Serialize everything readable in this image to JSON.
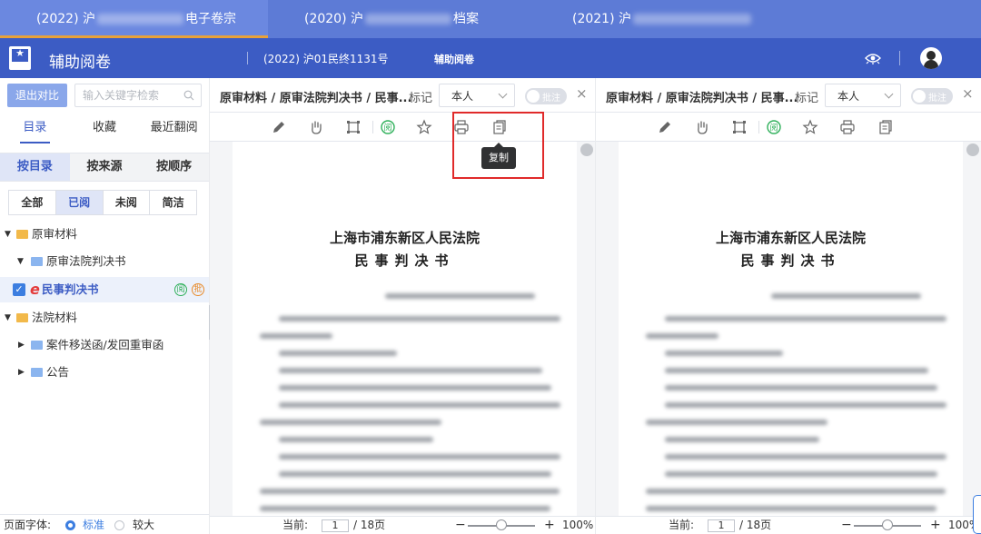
{
  "tabs": [
    {
      "prefix": "(2022) 沪",
      "suffix": "电子卷宗",
      "active": true
    },
    {
      "prefix": "(2020) 沪",
      "suffix": "档案",
      "active": false
    },
    {
      "prefix": "(2021) 沪",
      "suffix": "",
      "active": false
    }
  ],
  "header": {
    "title": "辅助阅卷",
    "logo_glyph": "★",
    "case_number": "(2022) 沪01民终1131号",
    "subtitle": "辅助阅卷"
  },
  "sidebar": {
    "compare_button": "退出对比",
    "search_placeholder": "输入关键字检索",
    "tabs": [
      "目录",
      "收藏",
      "最近翻阅"
    ],
    "active_tab": "目录",
    "modes": [
      "按目录",
      "按来源",
      "按顺序"
    ],
    "active_mode": "按目录",
    "filters": [
      "全部",
      "已阅",
      "未阅",
      "简洁"
    ],
    "active_filter": "已阅",
    "tree": [
      {
        "label": "原审材料",
        "caret": "▼",
        "folder": "yellow"
      },
      {
        "label": "原审法院判决书",
        "caret": "▼",
        "folder": "blue"
      },
      {
        "label": "民事判决书",
        "checked": true,
        "badge_read": "阅",
        "badge_note": "批"
      },
      {
        "label": "法院材料",
        "caret": "▼",
        "folder": "yellow"
      },
      {
        "label": "案件移送函/发回重审函",
        "caret": "▶",
        "folder": "blue"
      },
      {
        "label": "公告",
        "caret": "▶",
        "folder": "blue"
      }
    ],
    "font_size": {
      "label": "页面字体:",
      "options": [
        "标准",
        "较大"
      ],
      "selected": "标准"
    }
  },
  "panes": [
    {
      "breadcrumb": "原审材料 / 原审法院判决书 / 民事...",
      "mark_label": "标记",
      "person": "本人",
      "toggle_label": "批注",
      "close": "×",
      "read_badge": "阅",
      "court": "上海市浦东新区人民法院",
      "doc_type": "民事判决书",
      "page_label": "当前:",
      "page_current": "1",
      "page_total": "/ 18页",
      "zoom_minus": "−",
      "zoom_plus": "+",
      "zoom": "100%",
      "zoom_level": 0.5
    },
    {
      "breadcrumb": "原审材料 / 原审法院判决书 / 民事...",
      "mark_label": "标记",
      "person": "本人",
      "toggle_label": "批注",
      "close": "×",
      "read_badge": "阅",
      "court": "上海市浦东新区人民法院",
      "doc_type": "民事判决书",
      "page_label": "当前:",
      "page_current": "1",
      "page_total": "/ 18页",
      "zoom_minus": "−",
      "zoom_plus": "+",
      "zoom": "100%",
      "zoom_level": 0.5
    }
  ],
  "tooltip": "复制"
}
